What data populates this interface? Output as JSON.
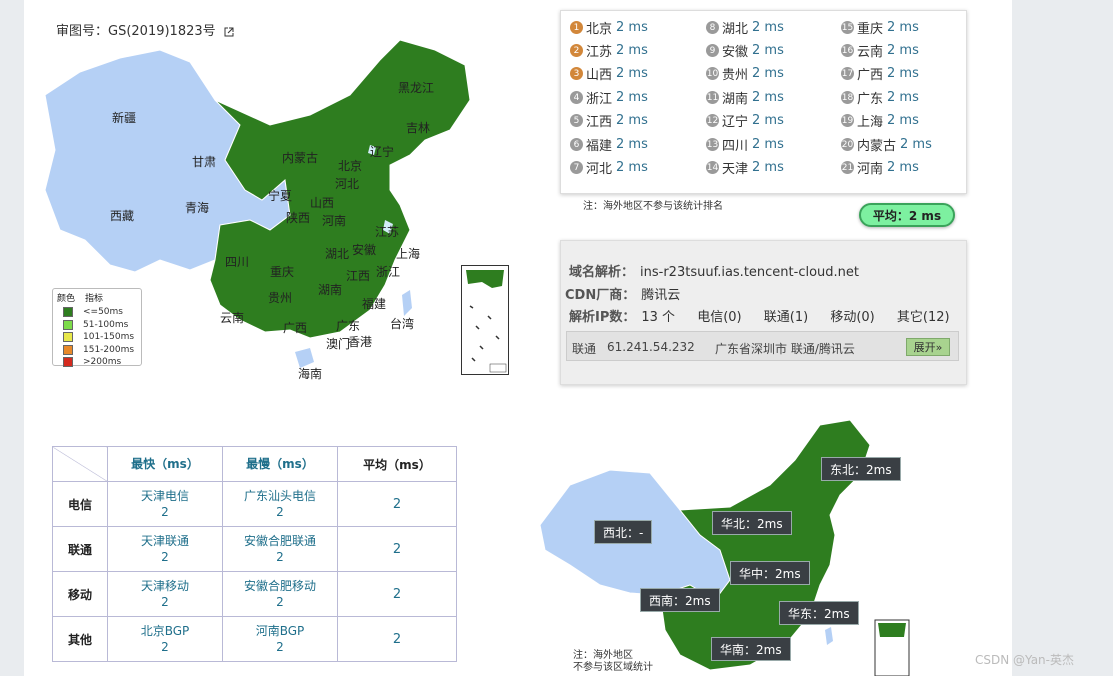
{
  "approval": "审图号：GS(2019)1823号",
  "map_labels": {
    "xinjiang": "新疆",
    "xizang": "西藏",
    "qinghai": "青海",
    "gansu": "甘肃",
    "neimenggu": "内蒙古",
    "heilongjiang": "黑龙江",
    "jilin": "吉林",
    "liaoning": "辽宁",
    "ningxia": "宁夏",
    "shaanxi": "陕西",
    "shanxi": "山西",
    "hebei": "河北",
    "henan": "河南",
    "jiangsu": "江苏",
    "shanghai": "上海",
    "anhui": "安徽",
    "sichuan": "四川",
    "chongqing": "重庆",
    "hubei": "湖北",
    "zhejiang": "浙江",
    "guizhou": "贵州",
    "hunan": "湖南",
    "jiangxi": "江西",
    "fujian": "福建",
    "yunnan": "云南",
    "guangxi": "广西",
    "guangdong": "广东",
    "taiwan": "台湾",
    "aomen": "澳门",
    "xianggang": "香港",
    "hainan": "海南",
    "beijing": "北京"
  },
  "legend": {
    "header_color": "颜色",
    "header_metric": "指标",
    "items": [
      {
        "label": "<=50ms",
        "color": "#2e7d1f"
      },
      {
        "label": "51-100ms",
        "color": "#7ddc4a"
      },
      {
        "label": "101-150ms",
        "color": "#e8e84a"
      },
      {
        "label": "151-200ms",
        "color": "#e8892a"
      },
      {
        "label": ">200ms",
        "color": "#d42a1e"
      }
    ]
  },
  "ranking": [
    {
      "num": "1",
      "prov": "北京",
      "ms": "2 ms"
    },
    {
      "num": "2",
      "prov": "江苏",
      "ms": "2 ms"
    },
    {
      "num": "3",
      "prov": "山西",
      "ms": "2 ms"
    },
    {
      "num": "4",
      "prov": "浙江",
      "ms": "2 ms"
    },
    {
      "num": "5",
      "prov": "江西",
      "ms": "2 ms"
    },
    {
      "num": "6",
      "prov": "福建",
      "ms": "2 ms"
    },
    {
      "num": "7",
      "prov": "河北",
      "ms": "2 ms"
    },
    {
      "num": "8",
      "prov": "湖北",
      "ms": "2 ms"
    },
    {
      "num": "9",
      "prov": "安徽",
      "ms": "2 ms"
    },
    {
      "num": "10",
      "prov": "贵州",
      "ms": "2 ms"
    },
    {
      "num": "11",
      "prov": "湖南",
      "ms": "2 ms"
    },
    {
      "num": "12",
      "prov": "辽宁",
      "ms": "2 ms"
    },
    {
      "num": "13",
      "prov": "四川",
      "ms": "2 ms"
    },
    {
      "num": "14",
      "prov": "天津",
      "ms": "2 ms"
    },
    {
      "num": "15",
      "prov": "重庆",
      "ms": "2 ms"
    },
    {
      "num": "16",
      "prov": "云南",
      "ms": "2 ms"
    },
    {
      "num": "17",
      "prov": "广西",
      "ms": "2 ms"
    },
    {
      "num": "18",
      "prov": "广东",
      "ms": "2 ms"
    },
    {
      "num": "19",
      "prov": "上海",
      "ms": "2 ms"
    },
    {
      "num": "20",
      "prov": "内蒙古",
      "ms": "2 ms"
    },
    {
      "num": "21",
      "prov": "河南",
      "ms": "2 ms"
    }
  ],
  "rank_colors": {
    "top": "#d2873a",
    "rest": "#9a9a9a"
  },
  "note_overseas": "注：海外地区不参与该统计排名",
  "average": "平均：2 ms",
  "dns": {
    "domain_label": "域名解析：",
    "domain": "ins-r23tsuuf.ias.tencent-cloud.net",
    "cdn_label": "CDN厂商：",
    "cdn": "腾讯云",
    "ip_label": "解析IP数：",
    "ip_count": "13 个",
    "telecom": "电信(0)",
    "unicom": "联通(1)",
    "mobile": "移动(0)",
    "other": "其它(12)",
    "row_isp": "联通",
    "row_ip": "61.241.54.232",
    "row_loc": "广东省深圳市 联通/腾讯云",
    "expand": "展开»"
  },
  "table": {
    "headers": [
      "最快（ms）",
      "最慢（ms）",
      "平均（ms）"
    ],
    "rows": [
      {
        "isp": "电信",
        "fast": "天津电信",
        "fast_ms": "2",
        "slow": "广东汕头电信",
        "slow_ms": "2",
        "avg": "2"
      },
      {
        "isp": "联通",
        "fast": "天津联通",
        "fast_ms": "2",
        "slow": "安徽合肥联通",
        "slow_ms": "2",
        "avg": "2"
      },
      {
        "isp": "移动",
        "fast": "天津移动",
        "fast_ms": "2",
        "slow": "安徽合肥移动",
        "slow_ms": "2",
        "avg": "2"
      },
      {
        "isp": "其他",
        "fast": "北京BGP",
        "fast_ms": "2",
        "slow": "河南BGP",
        "slow_ms": "2",
        "avg": "2"
      }
    ]
  },
  "regions": {
    "dongbei": "东北：2ms",
    "xibei": "西北：-",
    "huabei": "华北：2ms",
    "huazhong": "华中：2ms",
    "xinan": "西南：2ms",
    "huadong": "华东：2ms",
    "huanan": "华南：2ms"
  },
  "note_region_1": "注：海外地区",
  "note_region_2": "不参与该区域统计",
  "watermark": "CSDN @Yan-英杰",
  "colors": {
    "green": "#2e7d1f",
    "lightblue": "#b5d0f5",
    "accent": "#31708f"
  }
}
